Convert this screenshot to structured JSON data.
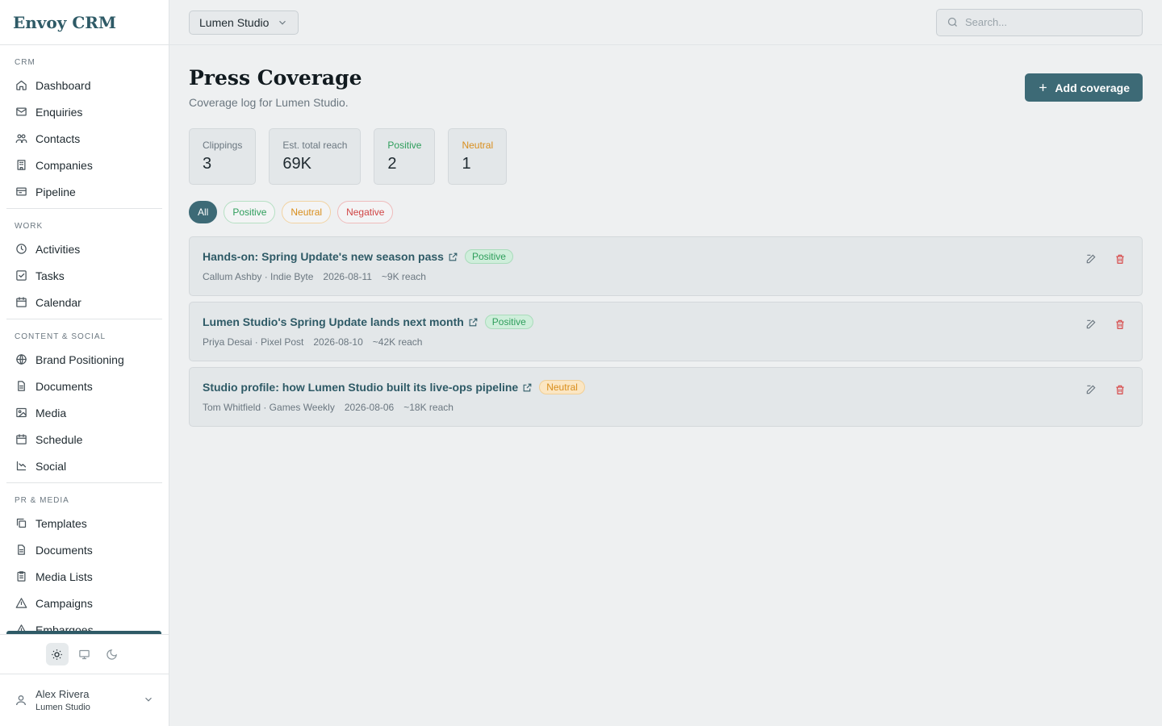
{
  "brand": "Envoy CRM",
  "sidebar": {
    "sections": [
      {
        "label": "CRM",
        "items": [
          {
            "label": "Dashboard",
            "icon": "home-icon"
          },
          {
            "label": "Enquiries",
            "icon": "mail-icon"
          },
          {
            "label": "Contacts",
            "icon": "users-icon"
          },
          {
            "label": "Companies",
            "icon": "building-icon"
          },
          {
            "label": "Pipeline",
            "icon": "pipeline-icon"
          }
        ]
      },
      {
        "label": "WORK",
        "items": [
          {
            "label": "Activities",
            "icon": "clock-icon"
          },
          {
            "label": "Tasks",
            "icon": "checkbox-icon"
          },
          {
            "label": "Calendar",
            "icon": "calendar-icon"
          }
        ]
      },
      {
        "label": "CONTENT & SOCIAL",
        "items": [
          {
            "label": "Brand Positioning",
            "icon": "globe-icon"
          },
          {
            "label": "Documents",
            "icon": "document-icon"
          },
          {
            "label": "Media",
            "icon": "image-icon"
          },
          {
            "label": "Schedule",
            "icon": "calendar-icon"
          },
          {
            "label": "Social",
            "icon": "chart-icon"
          }
        ]
      },
      {
        "label": "PR & MEDIA",
        "items": [
          {
            "label": "Templates",
            "icon": "copy-icon"
          },
          {
            "label": "Documents",
            "icon": "document-icon"
          },
          {
            "label": "Media Lists",
            "icon": "clipboard-icon"
          },
          {
            "label": "Campaigns",
            "icon": "warning-icon"
          },
          {
            "label": "Embargoes",
            "icon": "warning-icon"
          }
        ]
      }
    ],
    "user": {
      "name": "Alex Rivera",
      "org": "Lumen Studio"
    }
  },
  "topbar": {
    "org_select": "Lumen Studio",
    "search_placeholder": "Search..."
  },
  "page": {
    "title": "Press Coverage",
    "subtitle": "Coverage log for Lumen Studio.",
    "add_button": "Add coverage"
  },
  "stats": [
    {
      "label": "Clippings",
      "value": "3"
    },
    {
      "label": "Est. total reach",
      "value": "69K"
    },
    {
      "label": "Positive",
      "value": "2"
    },
    {
      "label": "Neutral",
      "value": "1"
    }
  ],
  "filters": [
    "All",
    "Positive",
    "Neutral",
    "Negative"
  ],
  "coverage": [
    {
      "title": "Hands-on: Spring Update's new season pass",
      "sentiment": "Positive",
      "author": "Callum Ashby · Indie Byte",
      "date": "2026-08-11",
      "reach": "~9K reach"
    },
    {
      "title": "Lumen Studio's Spring Update lands next month",
      "sentiment": "Positive",
      "author": "Priya Desai · Pixel Post",
      "date": "2026-08-10",
      "reach": "~42K reach"
    },
    {
      "title": "Studio profile: how Lumen Studio built its live-ops pipeline",
      "sentiment": "Neutral",
      "author": "Tom Whitfield · Games Weekly",
      "date": "2026-08-06",
      "reach": "~18K reach"
    }
  ],
  "colors": {
    "accent": "#3d6a76",
    "positive": "#2f9e5c",
    "neutral": "#d98e1c",
    "negative": "#d04545"
  }
}
